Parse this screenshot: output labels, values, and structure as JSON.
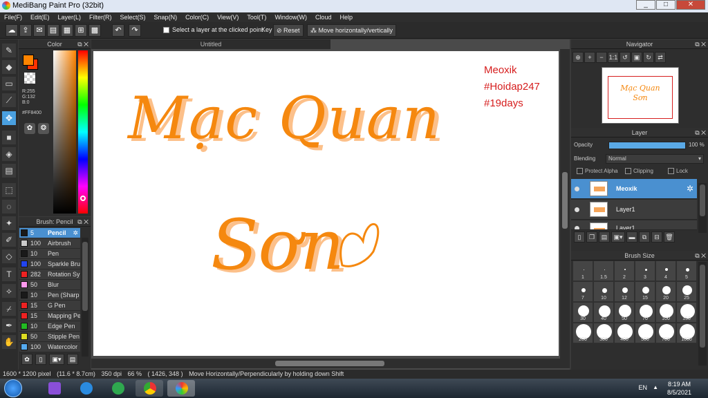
{
  "window": {
    "title": "MediBang Paint Pro (32bit)",
    "controls": [
      "_",
      "□",
      "✕"
    ]
  },
  "menu": [
    "File(F)",
    "Edit(E)",
    "Layer(L)",
    "Filter(R)",
    "Select(S)",
    "Snap(N)",
    "Color(C)",
    "View(V)",
    "Tool(T)",
    "Window(W)",
    "Cloud",
    "Help"
  ],
  "toolbar": {
    "select_layer_label": "Select a layer at the clicked point",
    "key_label": "Key",
    "reset_label": "Reset",
    "move_label": "Move horizontally/vertically"
  },
  "color_panel": {
    "title": "Color",
    "r": "R:255",
    "g": "G:132",
    "b": "B:0",
    "hex": "#FF8400",
    "fg": "#FF8400",
    "bg": "#FF3300"
  },
  "brush_panel": {
    "title": "Brush: Pencil",
    "items": [
      {
        "size": "5",
        "name": "Pencil",
        "color": "#1a1a1a"
      },
      {
        "size": "100",
        "name": "Airbrush",
        "color": "#cccccc"
      },
      {
        "size": "10",
        "name": "Pen",
        "color": "#1a1a1a"
      },
      {
        "size": "100",
        "name": "Sparkle Bru",
        "color": "#2244ee"
      },
      {
        "size": "282",
        "name": "Rotation Sy",
        "color": "#ee2222"
      },
      {
        "size": "50",
        "name": "Blur",
        "color": "#ff99ee"
      },
      {
        "size": "10",
        "name": "Pen (Sharp",
        "color": "#1a1a1a"
      },
      {
        "size": "15",
        "name": "G Pen",
        "color": "#ee2222"
      },
      {
        "size": "15",
        "name": "Mapping Pe",
        "color": "#ee2222"
      },
      {
        "size": "10",
        "name": "Edge Pen",
        "color": "#22bb22"
      },
      {
        "size": "50",
        "name": "Stipple Pen",
        "color": "#dddd22"
      },
      {
        "size": "100",
        "name": "Watercolor",
        "color": "#55aaee"
      }
    ]
  },
  "document": {
    "tab": "Untitled",
    "lettering": [
      "Mạc Quan",
      "Sơn"
    ],
    "red_text": [
      "Meoxik",
      "#Hoidap247",
      "#19days"
    ]
  },
  "navigator": {
    "title": "Navigator",
    "preview_text": [
      "Mạc Quan",
      "Sơn"
    ]
  },
  "layer_panel": {
    "title": "Layer",
    "opacity_label": "Opacity",
    "opacity_value": "100 %",
    "opacity_fraction": 1.0,
    "blending_label": "Blending",
    "blending_value": "Normal",
    "protect_alpha": "Protect Alpha",
    "clipping": "Clipping",
    "lock": "Lock",
    "layers": [
      "Meoxik",
      "Layer1",
      "Layer1"
    ]
  },
  "brush_size": {
    "title": "Brush Size",
    "sizes": [
      "1",
      "1.5",
      "2",
      "3",
      "4",
      "5",
      "7",
      "10",
      "12",
      "15",
      "20",
      "25",
      "30",
      "40",
      "50",
      "70",
      "100",
      "150",
      "200",
      "300",
      "400",
      "500",
      "700",
      "1000"
    ]
  },
  "status": {
    "dimensions": "1600 * 1200 pixel",
    "physical": "(11.6 * 8.7cm)",
    "dpi": "350 dpi",
    "zoom": "66 %",
    "coords": "( 1426, 348 )",
    "message": "Move Horizontally/Perpendicularly by holding down Shift"
  },
  "taskbar": {
    "lang": "EN",
    "time": "8:19 AM",
    "date": "8/5/2021"
  }
}
